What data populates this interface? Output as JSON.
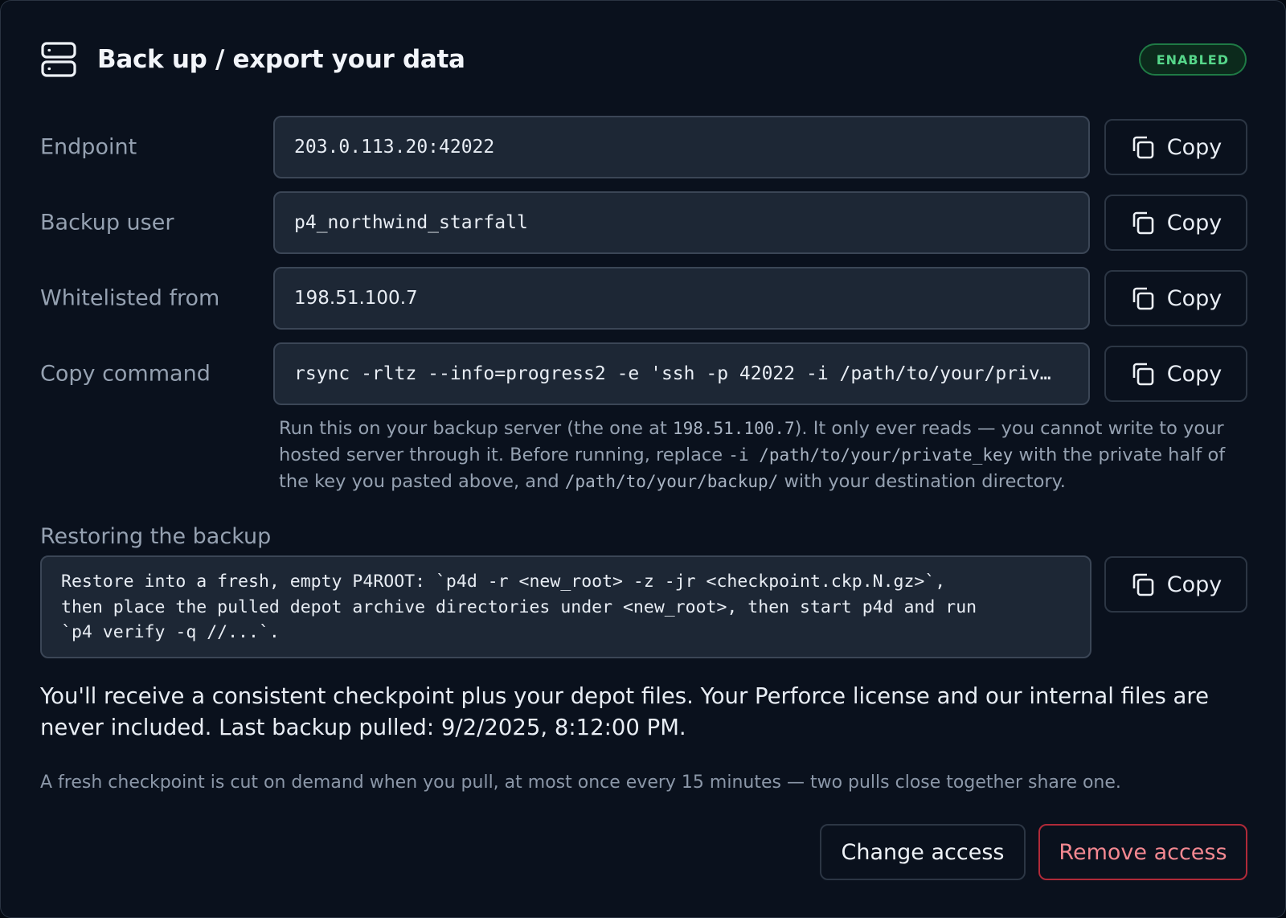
{
  "header": {
    "icon": "server-icon",
    "title": "Back up / export your data",
    "status_badge": "ENABLED"
  },
  "fields": [
    {
      "label": "Endpoint",
      "value": "203.0.113.20:42022",
      "copy_label": "Copy"
    },
    {
      "label": "Backup user",
      "value": "p4_northwind_starfall",
      "copy_label": "Copy"
    },
    {
      "label": "Whitelisted from",
      "value": "198.51.100.7",
      "copy_label": "Copy"
    },
    {
      "label": "Copy command",
      "value": "rsync -rltz --info=progress2 -e 'ssh -p 42022 -i /path/to/your/priv…",
      "copy_label": "Copy"
    }
  ],
  "hint": {
    "part1": "Run this on your backup server (the one at ",
    "ip": "198.51.100.7",
    "part2": "). It only ever reads — you cannot write to your hosted server through it. Before running, replace ",
    "key_flag": "-i /path/to/your/private_key",
    "part3": " with the private half of the key you pasted above, and ",
    "backup_path": "/path/to/your/backup/",
    "part4": " with your destination directory."
  },
  "restore": {
    "label": "Restoring the backup",
    "text": "Restore into a fresh, empty P4ROOT: `p4d -r <new_root> -z -jr <checkpoint.ckp.N.gz>`,\nthen place the pulled depot archive directories under <new_root>, then start p4d and run\n`p4 verify -q //...`.",
    "copy_label": "Copy"
  },
  "info_text": "You'll receive a consistent checkpoint plus your depot files. Your Perforce license and our internal files are never included. Last backup pulled: 9/2/2025, 8:12:00 PM.",
  "note_text": "A fresh checkpoint is cut on demand when you pull, at most once every 15 minutes — two pulls close together share one.",
  "actions": {
    "change_label": "Change access",
    "remove_label": "Remove access"
  },
  "colors": {
    "background": "#0a111d",
    "field_bg": "#1d2735",
    "badge_green": "#56d68a",
    "danger": "#f48891"
  }
}
